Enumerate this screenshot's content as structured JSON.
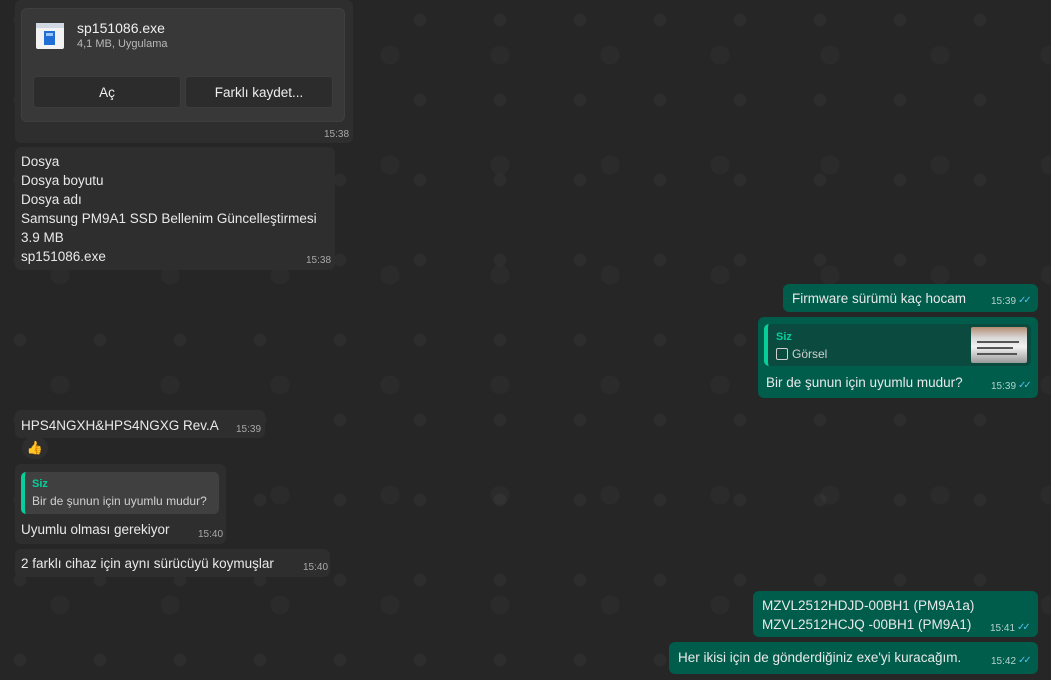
{
  "file_message": {
    "file_name": "sp151086.exe",
    "file_meta": "4,1 MB, Uygulama",
    "open_label": "Aç",
    "save_as_label": "Farklı kaydet...",
    "time": "15:38"
  },
  "info_message": {
    "lines": [
      "Dosya",
      "Dosya boyutu",
      "Dosya adı",
      "Samsung PM9A1 SSD Bellenim Güncelleştirmesi",
      "3.9 MB",
      "sp151086.exe"
    ],
    "time": "15:38"
  },
  "outgoing_1": {
    "text": "Firmware sürümü kaç hocam",
    "time": "15:39"
  },
  "outgoing_2": {
    "quote_author": "Siz",
    "quote_text": "Görsel",
    "quote_icon": "image-icon",
    "text": "Bir de şunun için uyumlu mudur?",
    "time": "15:39"
  },
  "incoming_model": {
    "text": "HPS4NGXH&HPS4NGXG Rev.A",
    "time": "15:39"
  },
  "reaction": {
    "emoji": "👍"
  },
  "incoming_reply": {
    "quote_author": "Siz",
    "quote_text": "Bir de şunun için uyumlu mudur?",
    "text": "Uyumlu olması gerekiyor",
    "time": "15:40"
  },
  "incoming_driver": {
    "text": "2 farklı cihaz için aynı sürücüyü koymuşlar",
    "time": "15:40"
  },
  "outgoing_3": {
    "lines": [
      "MZVL2512HDJD-00BH1 (PM9A1a)",
      "MZVL2512HCJQ -00BH1 (PM9A1)"
    ],
    "time": "15:41"
  },
  "outgoing_4": {
    "text": "Her ikisi için de gönderdiğiniz exe'yi kuracağım.",
    "time": "15:42"
  },
  "colors": {
    "incoming": "#2e2e2e",
    "outgoing": "#005c4b",
    "accent": "#06cf9c",
    "read_ticks": "#53bdeb"
  }
}
